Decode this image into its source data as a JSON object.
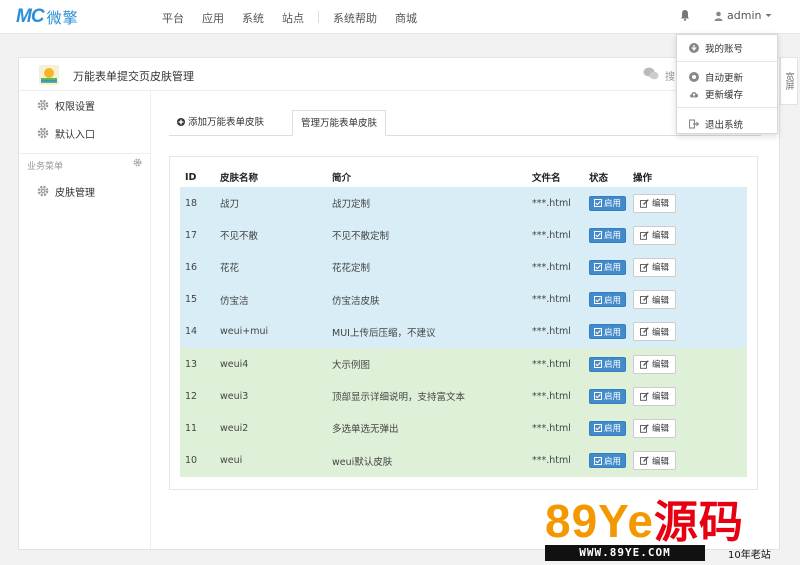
{
  "brand": {
    "mark": "MC",
    "name": "微擎"
  },
  "topnav": [
    "平台",
    "应用",
    "系统",
    "站点",
    "系统帮助",
    "商城"
  ],
  "user": {
    "name": "admin"
  },
  "panel": {
    "title": "万能表单提交页皮肤管理",
    "head_right": "搜"
  },
  "sidebar": {
    "items": [
      {
        "label": "权限设置"
      },
      {
        "label": "默认入口"
      }
    ],
    "section_label": "业务菜单",
    "section_items": [
      {
        "label": "皮肤管理"
      }
    ]
  },
  "tabs": [
    {
      "label": "添加万能表单皮肤"
    },
    {
      "label": "管理万能表单皮肤"
    }
  ],
  "table": {
    "headers": [
      "ID",
      "皮肤名称",
      "简介",
      "文件名",
      "状态",
      "操作"
    ],
    "enable_label": "启用",
    "edit_label": "编辑",
    "rows": [
      {
        "id": "18",
        "name": "战刀",
        "desc": "战刀定制",
        "file": "***.html",
        "group": "blue"
      },
      {
        "id": "17",
        "name": "不见不散",
        "desc": "不见不散定制",
        "file": "***.html",
        "group": "blue"
      },
      {
        "id": "16",
        "name": "花花",
        "desc": "花花定制",
        "file": "***.html",
        "group": "blue"
      },
      {
        "id": "15",
        "name": "仿宝洁",
        "desc": "仿宝洁皮肤",
        "file": "***.html",
        "group": "blue"
      },
      {
        "id": "14",
        "name": "weui+mui",
        "desc": "MUI上传后压缩，不建议",
        "file": "***.html",
        "group": "blue"
      },
      {
        "id": "13",
        "name": "weui4",
        "desc": "大示例图",
        "file": "***.html",
        "group": "green"
      },
      {
        "id": "12",
        "name": "weui3",
        "desc": "顶部显示详细说明，支持富文本",
        "file": "***.html",
        "group": "green"
      },
      {
        "id": "11",
        "name": "weui2",
        "desc": "多选单选无弹出",
        "file": "***.html",
        "group": "green"
      },
      {
        "id": "10",
        "name": "weui",
        "desc": "weui默认皮肤",
        "file": "***.html",
        "group": "green"
      }
    ]
  },
  "dropdown": {
    "items": [
      {
        "label": "我的账号"
      },
      {
        "label": "自动更新"
      },
      {
        "label": "更新缓存"
      },
      {
        "label": "退出系统"
      }
    ]
  },
  "right_tab": "宽屏",
  "watermark": {
    "big_a": "89",
    "big_b": "Ye",
    "big_c": "源码",
    "url": "WWW.89YE.COM",
    "tag": "10年老站"
  },
  "colors": {
    "brand": "#2a8fd6",
    "primary": "#428bca",
    "row_blue": "#d9edf7",
    "row_green": "#dff0d8"
  }
}
